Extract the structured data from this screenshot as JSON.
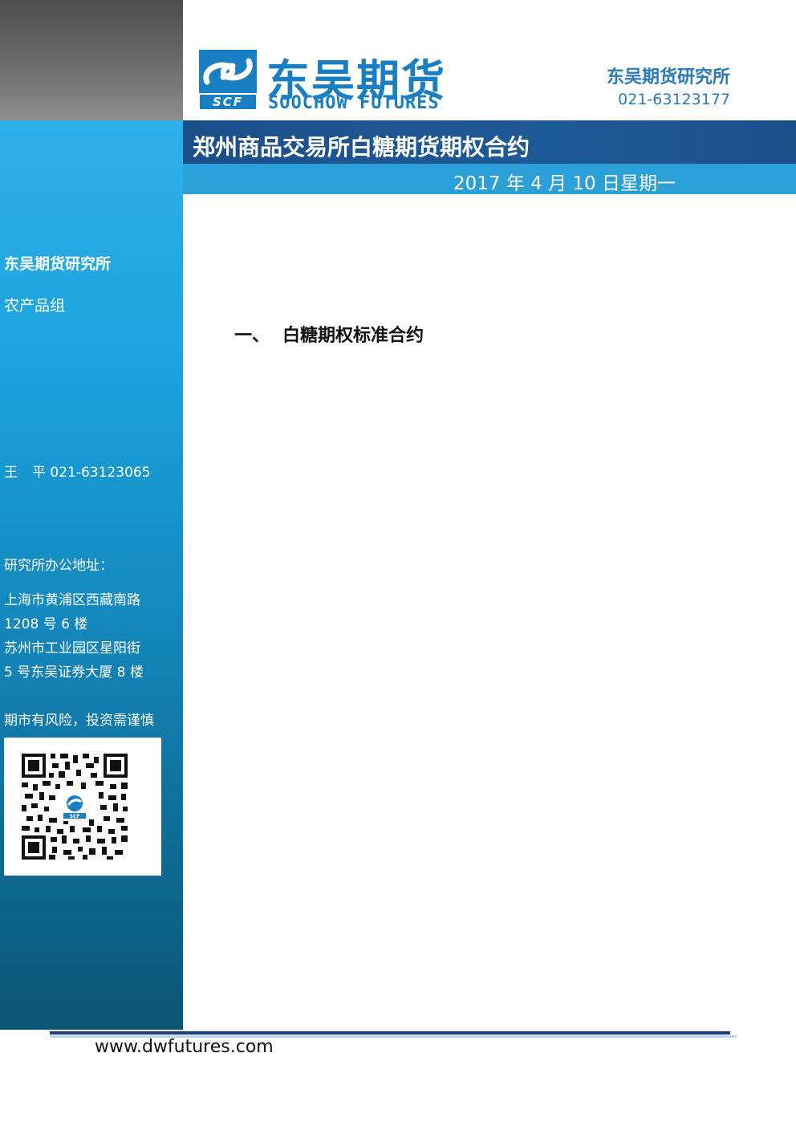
{
  "header": {
    "logo_cn": "东吴期货",
    "logo_en": "SOOCHOW FUTURES",
    "logo_mark_text": "SCF",
    "institute": "东吴期货研究所",
    "phone": "021-63123177"
  },
  "title_bar": {
    "title": "郑州商品交易所白糖期货期权合约",
    "date": "2017 年 4 月 10 日星期一"
  },
  "sidebar": {
    "department": "东吴期货研究所",
    "group": "农产品组",
    "contact_name_1": "王",
    "contact_name_2": "平",
    "contact_phone": "021-63123065",
    "address_label": "研究所办公地址：",
    "address_lines": [
      "上海市黄浦区西藏南路",
      "1208 号 6 楼",
      "苏州市工业园区星阳街",
      "5 号东吴证券大厦 8 楼"
    ],
    "risk_notice": "期市有风险，投资需谨慎",
    "qr_logo_text": "SCF"
  },
  "main": {
    "section_number": "一、",
    "section_title": "白糖期权标准合约"
  },
  "footer": {
    "url": "www.dwfutures.com"
  },
  "colors": {
    "brand_blue": "#1a7fc2",
    "title_bar": "#1f5a98",
    "date_bar": "#2a9fd8",
    "sidebar_top": "#2fb0ea",
    "sidebar_bottom": "#0a5676"
  }
}
